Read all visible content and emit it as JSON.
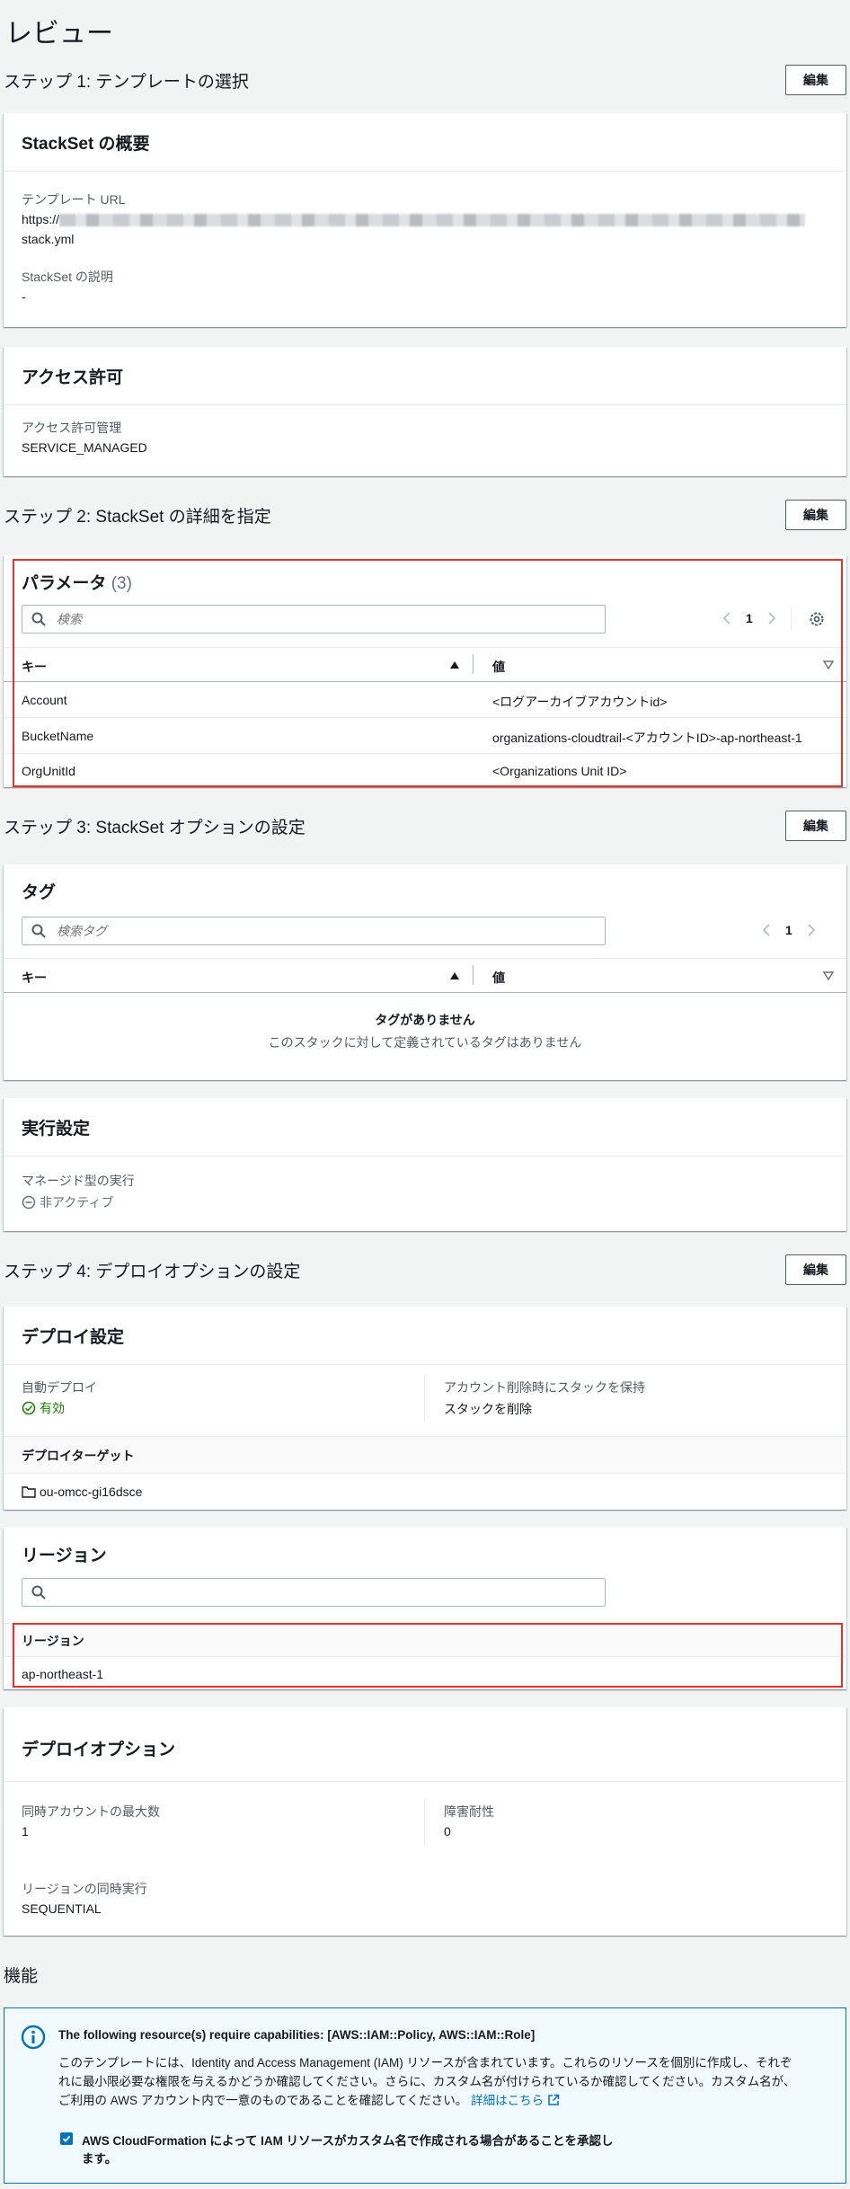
{
  "page_title": "レビュー",
  "edit_label": "編集",
  "step1": {
    "title": "ステップ 1: テンプレートの選択",
    "overview": {
      "title": "StackSet の概要",
      "template_url_label": "テンプレート URL",
      "template_url_prefix": "https://",
      "template_url_suffix": "stack.yml",
      "description_label": "StackSet の説明",
      "description_value": "-"
    },
    "permissions": {
      "title": "アクセス許可",
      "mgmt_label": "アクセス許可管理",
      "mgmt_value": "SERVICE_MANAGED"
    }
  },
  "step2": {
    "title": "ステップ 2: StackSet の詳細を指定",
    "params": {
      "title": "パラメータ",
      "count": "(3)",
      "search_placeholder": "検索",
      "page": "1",
      "col_key": "キー",
      "col_value": "値",
      "rows": [
        {
          "key": "Account",
          "value": "<ログアーカイブアカウントid>"
        },
        {
          "key": "BucketName",
          "value": "organizations-cloudtrail-<アカウントID>-ap-northeast-1"
        },
        {
          "key": "OrgUnitId",
          "value": "<Organizations Unit ID>"
        }
      ]
    }
  },
  "step3": {
    "title": "ステップ 3: StackSet オプションの設定",
    "tags": {
      "title": "タグ",
      "search_placeholder": "検索タグ",
      "page": "1",
      "col_key": "キー",
      "col_value": "値",
      "empty_title": "タグがありません",
      "empty_desc": "このスタックに対して定義されているタグはありません"
    },
    "execution": {
      "title": "実行設定",
      "managed_label": "マネージド型の実行",
      "managed_value": "非アクティブ"
    }
  },
  "step4": {
    "title": "ステップ 4: デプロイオプションの設定",
    "deploy": {
      "title": "デプロイ設定",
      "auto_label": "自動デプロイ",
      "auto_value": "有効",
      "retain_label": "アカウント削除時にスタックを保持",
      "retain_value": "スタックを削除",
      "targets_label": "デプロイターゲット",
      "target_ou": "ou-omcc-gi16dsce"
    },
    "regions": {
      "title": "リージョン",
      "col_region": "リージョン",
      "region_value": "ap-northeast-1"
    },
    "options": {
      "title": "デプロイオプション",
      "max_accounts_label": "同時アカウントの最大数",
      "max_accounts_value": "1",
      "fault_label": "障害耐性",
      "fault_value": "0",
      "concurrency_label": "リージョンの同時実行",
      "concurrency_value": "SEQUENTIAL"
    }
  },
  "capabilities": {
    "title": "機能",
    "heading": "The following resource(s) require capabilities: [AWS::IAM::Policy, AWS::IAM::Role]",
    "body_line1": "このテンプレートには、Identity and Access Management (IAM) リソースが含まれています。これらのリソースを個別に作成し、それぞ",
    "body_line2": "れに最小限必要な権限を与えるかどうか確認してください。さらに、カスタム名が付けられているか確認してください。カスタム名が、",
    "body_line3": "ご利用の AWS アカウント内で一意のものであることを確認してください。",
    "link": "詳細はこちら",
    "ack_line1": "AWS CloudFormation によって IAM リソースがカスタム名で作成される場合があることを承認し",
    "ack_line2": "ます。"
  },
  "colors": {
    "accent": "#0073bb",
    "success": "#1d8102",
    "highlight": "#e4332a",
    "background": "#f2f3f3"
  }
}
